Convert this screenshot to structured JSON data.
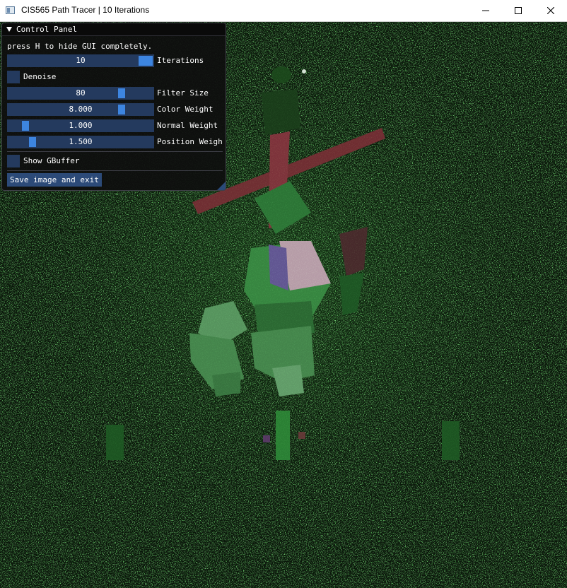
{
  "window": {
    "title": "CIS565 Path Tracer | 10 Iterations"
  },
  "panel": {
    "title": "Control Panel",
    "hint": "press H to hide GUI completely.",
    "iterations": {
      "value": "10",
      "label": "Iterations",
      "fraction": 1.0
    },
    "denoise": {
      "label": "Denoise",
      "checked": false
    },
    "filter_size": {
      "value": "80",
      "label": "Filter Size",
      "fraction": 0.8
    },
    "color_weight": {
      "value": "8.000",
      "label": "Color Weight",
      "fraction": 0.8
    },
    "normal_weight": {
      "value": "1.000",
      "label": "Normal Weight",
      "fraction": 0.1
    },
    "position_weight": {
      "value": "1.500",
      "label": "Position Weigh",
      "fraction": 0.15
    },
    "show_gbuffer": {
      "label": "Show GBuffer",
      "checked": false
    },
    "save_button": "Save image and exit"
  },
  "colors": {
    "slider_bg": "#243a5e",
    "slider_grab": "#3d85e0",
    "button_bg": "#2c4a78",
    "panel_bg": "#0f0f0f",
    "noise_green": "#1f6b1f"
  },
  "icons": {
    "app": "app-window-icon",
    "minimize": "minimize-icon",
    "maximize": "maximize-icon",
    "close": "close-icon",
    "collapse": "collapse-triangle-icon"
  }
}
